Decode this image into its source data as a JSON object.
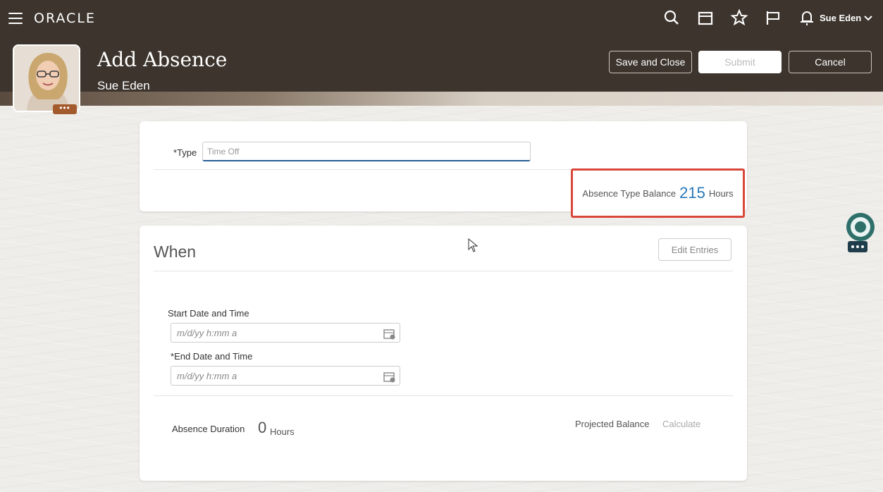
{
  "header": {
    "logo": "ORACLE",
    "user_name": "Sue Eden",
    "page_title": "Add Absence",
    "page_subtitle": "Sue Eden",
    "buttons": {
      "save_close": "Save and Close",
      "submit": "Submit",
      "cancel": "Cancel"
    },
    "icons": [
      "search-icon",
      "home-icon",
      "favorites-star-icon",
      "flag-icon",
      "notifications-bell-icon"
    ]
  },
  "what": {
    "type_label": "Type",
    "type_required_marker": "*",
    "type_value": "Time Off",
    "balance_label": "Absence Type Balance",
    "balance_value": "215",
    "balance_unit": "Hours"
  },
  "when": {
    "title": "When",
    "edit_entries": "Edit Entries",
    "start_label": "Start Date and Time",
    "start_placeholder": "m/d/yy h:mm a",
    "end_required_marker": "*",
    "end_label": "End Date and Time",
    "end_placeholder": "m/d/yy h:mm a",
    "duration_label": "Absence Duration",
    "duration_value": "0",
    "duration_unit": "Hours",
    "projected_balance_label": "Projected Balance",
    "calculate_link": "Calculate"
  },
  "colors": {
    "header_bg": "#3c342d",
    "highlight_border": "#d8473a",
    "balance_value": "#2a78b7",
    "input_focus": "#2a5d96"
  }
}
